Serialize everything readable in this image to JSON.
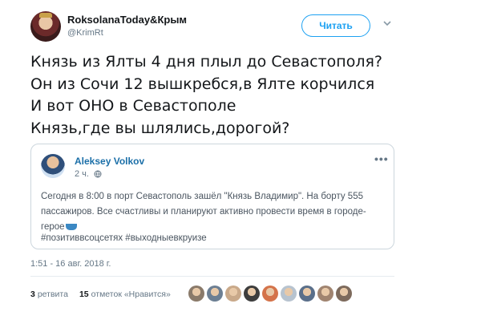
{
  "author": {
    "display_name": "RoksolanaToday&Крым",
    "handle": "@KrimRt"
  },
  "follow_button": {
    "label": "Читать"
  },
  "tweet_text": [
    "Князь из Ялты 4 дня плыл до Севастополя?",
    "Он из Сочи 12 вышкребся,в Ялте корчился",
    "И вот ОНО в Севастополе",
    "Князь,где вы шлялись,дорогой?"
  ],
  "quoted_tweet": {
    "author": "Aleksey Volkov",
    "time": "2 ч.",
    "more": "•••",
    "text_lines": [
      "Сегодня в 8:00 в порт Севастополь зашёл \"Князь Владимир\". На борту 555",
      "пассажиров. Все счастливы и планируют активно провести время в городе-",
      "герое"
    ],
    "hashtags": "#позитиввсоцсетях #выходныевкруизе"
  },
  "timestamp": "1:51 - 16 авг. 2018 г.",
  "stats": {
    "retweets_count": "3",
    "retweets_label": "ретвита",
    "likes_count": "15",
    "likes_label": "отметок «Нравится»"
  },
  "likers_colors": [
    "#8a7a6a",
    "#6c7f93",
    "#c9a98a",
    "#3d3d3d",
    "#d4734a",
    "#b7c3cf",
    "#5a6f8a",
    "#a08470",
    "#7d6a5c"
  ],
  "colors": {
    "accent": "#1da1f2",
    "link": "#1b6fa8",
    "muted": "#657786"
  }
}
